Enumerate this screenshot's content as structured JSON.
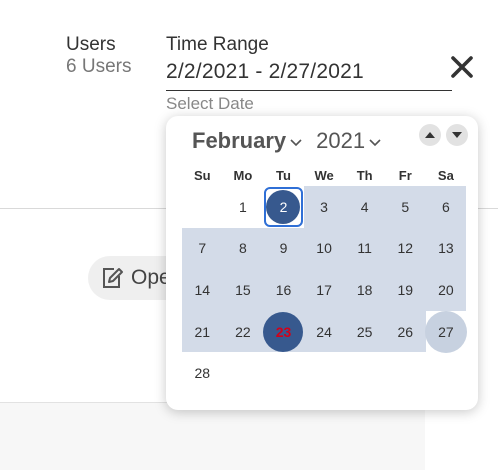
{
  "filters": {
    "users_label": "Users",
    "users_count": "6 Users",
    "time_range_label": "Time Range",
    "time_range_value": "2/2/2021 - 2/27/2021",
    "select_date_hint": "Select Date"
  },
  "open_button_label": "Ope",
  "calendar": {
    "month": "February",
    "year": "2021",
    "weekdays": [
      "Su",
      "Mo",
      "Tu",
      "We",
      "Th",
      "Fr",
      "Sa"
    ],
    "first_weekday_index": 1,
    "days_in_month": 28,
    "range_start_day": 2,
    "range_end_day": 27,
    "today_day": 23
  },
  "colors": {
    "range_fill": "#d3dbe8",
    "selected_fill": "#37598e",
    "focus_ring": "#2f6fd6",
    "today_text": "#d0021b",
    "end_fill": "#c7d1e0"
  },
  "icons": {
    "close": "close-icon",
    "edit": "edit-icon",
    "month_chevron": "chevron-down-icon",
    "prev": "arrow-up-icon",
    "next": "arrow-down-icon"
  }
}
